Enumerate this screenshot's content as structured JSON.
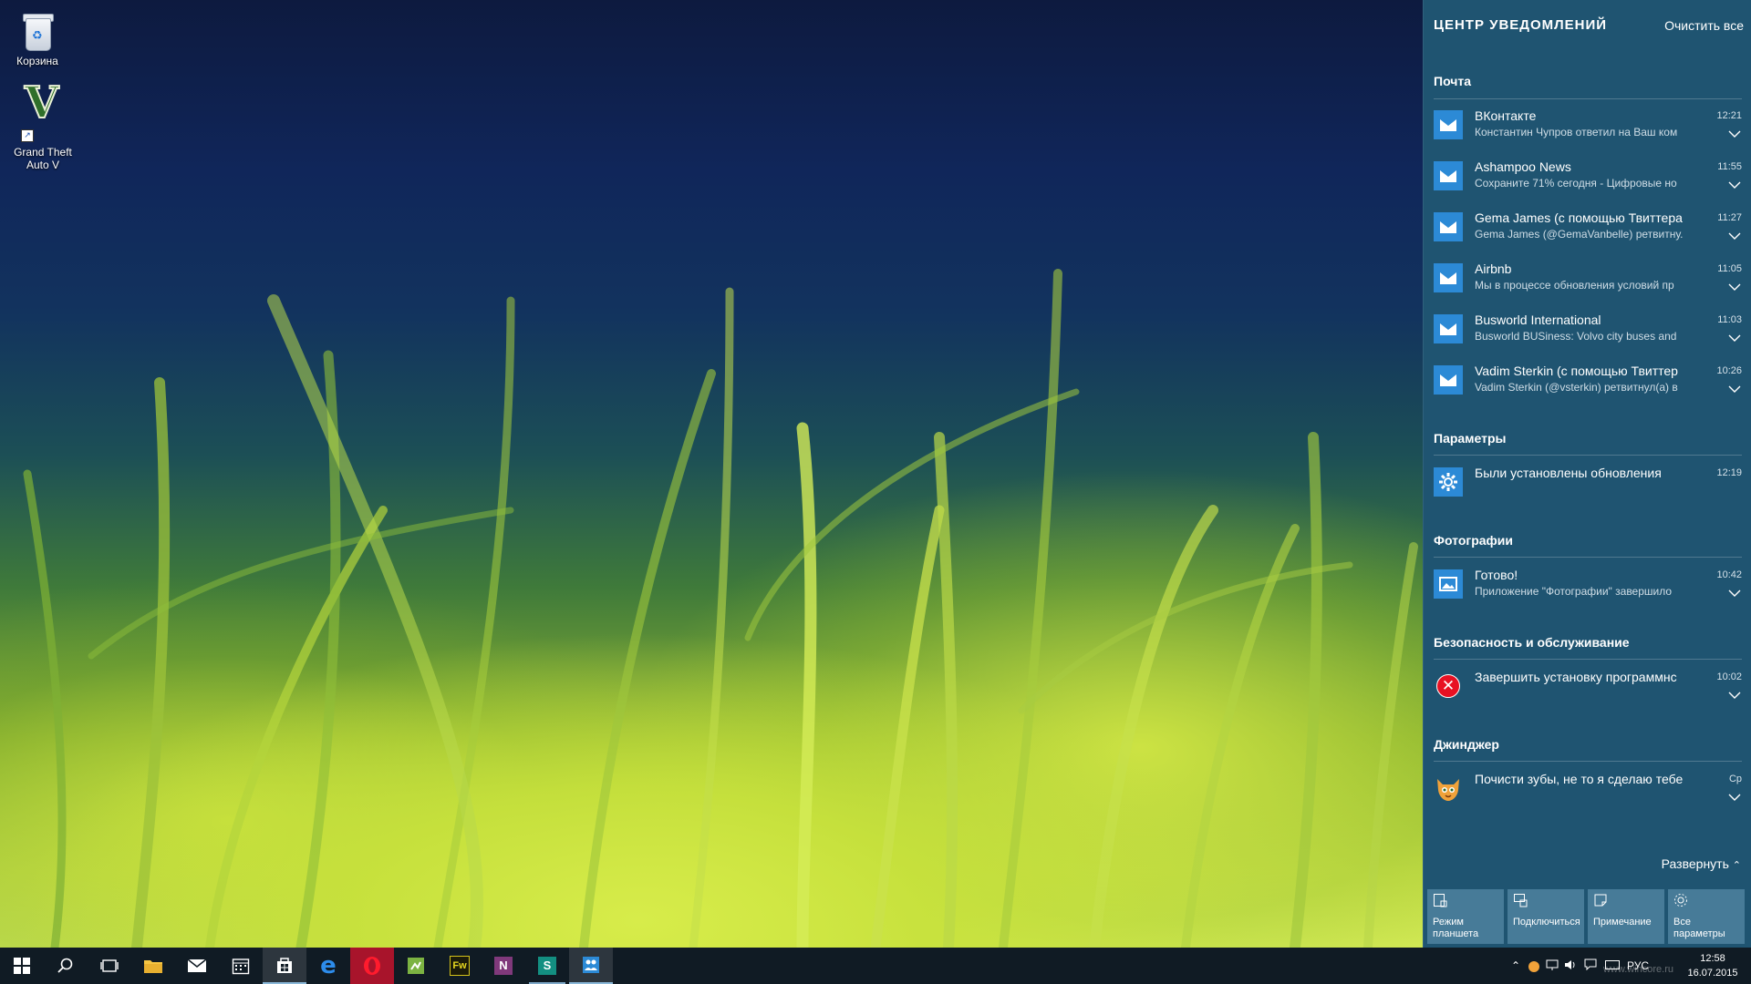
{
  "desktop": {
    "icons": [
      {
        "label": "Корзина",
        "icon": "recycle-bin-icon"
      },
      {
        "label": "Grand Theft Auto V",
        "icon": "gta-v-icon"
      }
    ]
  },
  "action_center": {
    "title": "ЦЕНТР УВЕДОМЛЕНИЙ",
    "clear_all": "Очистить все",
    "groups": [
      {
        "name": "Почта",
        "items": [
          {
            "title": "ВКонтакте",
            "body": "Константин Чупров ответил на Ваш ком",
            "time": "12:21"
          },
          {
            "title": "Ashampoo News",
            "body": "Сохраните 71% сегодня - Цифровые но",
            "time": "11:55"
          },
          {
            "title": "Gema James (с помощью Твиттера",
            "body": "Gema James (@GemaVanbelle) ретвитну.",
            "time": "11:27"
          },
          {
            "title": "Airbnb",
            "body": "Мы в процессе обновления условий пр",
            "time": "11:05"
          },
          {
            "title": "Busworld International",
            "body": "Busworld BUSiness:  Volvo city buses and",
            "time": "11:03"
          },
          {
            "title": "Vadim Sterkin (с помощью Твиттер",
            "body": "Vadim Sterkin (@vsterkin) ретвитнул(а) в",
            "time": "10:26"
          }
        ]
      },
      {
        "name": "Параметры",
        "items": [
          {
            "title": "Были установлены обновления",
            "body": "",
            "time": "12:19"
          }
        ]
      },
      {
        "name": "Фотографии",
        "items": [
          {
            "title": "Готово!",
            "body": "Приложение \"Фотографии\" завершило",
            "time": "10:42"
          }
        ]
      },
      {
        "name": "Безопасность и обслуживание",
        "items": [
          {
            "title": "Завершить установку программнс",
            "body": "",
            "time": "10:02"
          }
        ]
      },
      {
        "name": "Джинджер",
        "items": [
          {
            "title": "Почисти зубы, не то я сделаю тебе",
            "body": "",
            "time": "Ср"
          }
        ]
      }
    ],
    "expand_label": "Развернуть",
    "quick_actions": [
      {
        "label": "Режим планшета",
        "icon": "tablet-mode-icon"
      },
      {
        "label": "Подключиться",
        "icon": "connect-icon"
      },
      {
        "label": "Примечание",
        "icon": "note-icon"
      },
      {
        "label": "Все параметры",
        "icon": "gear-icon"
      }
    ]
  },
  "taskbar": {
    "items": [
      "start",
      "search",
      "task-view",
      "file-explorer",
      "mail",
      "calendar",
      "store",
      "edge",
      "opera",
      "app-green",
      "fireworks",
      "onenote",
      "sway",
      "people"
    ],
    "language": "РУС",
    "time": "12:58",
    "date": "16.07.2015",
    "watermark": "www.wincore.ru"
  },
  "colors": {
    "action_center_bg": "#1f5471",
    "accent": "#2c8ad6",
    "taskbar_bg": "#101b24",
    "error": "#e81123"
  }
}
